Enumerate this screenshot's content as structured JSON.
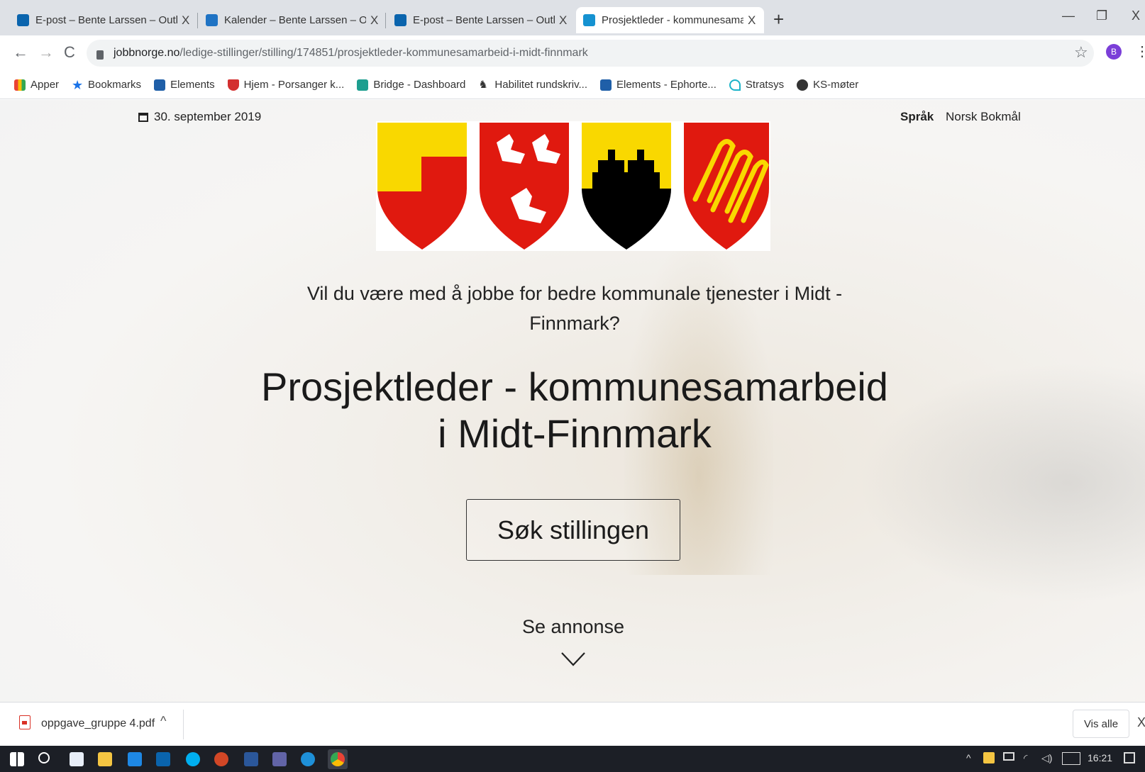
{
  "browser": {
    "tabs": [
      {
        "title": "E-post – Bente Larssen – Outlook",
        "active": false,
        "favicon_color": "#0a64ad"
      },
      {
        "title": "Kalender – Bente Larssen – Outlo",
        "active": false,
        "favicon_color": "#1f73c4"
      },
      {
        "title": "E-post – Bente Larssen – Outlook",
        "active": false,
        "favicon_color": "#0a64ad"
      },
      {
        "title": "Prosjektleder - kommunesamarb",
        "active": true,
        "favicon_color": "#1592d1"
      }
    ],
    "tab_close_glyph": "X",
    "new_tab_glyph": "+",
    "window_controls": {
      "minimize": "—",
      "restore": "❐",
      "close": "X"
    },
    "url_host": "jobbnorge.no",
    "url_path": "/ledige-stillinger/stilling/174851/prosjektleder-kommunesamarbeid-i-midt-finnmark",
    "profile_initial": "B",
    "bookmarks": [
      {
        "label": "Apper",
        "icon": "apps-grid-icon",
        "color": "#ea4335"
      },
      {
        "label": "Bookmarks",
        "icon": "star-icon",
        "color": "#1a73e8"
      },
      {
        "label": "Elements",
        "icon": "elements-icon",
        "color": "#1f5fa8"
      },
      {
        "label": "Hjem - Porsanger k...",
        "icon": "porsanger-crest-icon",
        "color": "#d32f2f"
      },
      {
        "label": "Bridge - Dashboard",
        "icon": "bridge-icon",
        "color": "#1d9e8f"
      },
      {
        "label": "Habilitet rundskriv...",
        "icon": "lion-icon",
        "color": "#333333"
      },
      {
        "label": "Elements - Ephorte...",
        "icon": "elements-icon",
        "color": "#1f5fa8"
      },
      {
        "label": "Stratsys",
        "icon": "stratsys-icon",
        "color": "#1bb3c8"
      },
      {
        "label": "KS-møter",
        "icon": "globe-icon",
        "color": "#333333"
      }
    ]
  },
  "page": {
    "date": "30. september 2019",
    "language_label": "Språk",
    "language_value": "Norsk Bokmål",
    "intro": "Vil du være med å jobbe for bedre kommunale tjenester i Midt - Finnmark?",
    "title_line1": "Prosjektleder - kommunesamarbeid",
    "title_line2": "i Midt-Finnmark",
    "apply_button": "Søk stillingen",
    "see_ad": "Se annonse"
  },
  "downloads": {
    "file_name": "oppgave_gruppe 4.pdf",
    "show_all": "Vis alle",
    "close_glyph": "X"
  },
  "taskbar": {
    "clock": "16:21",
    "tray_caret": "^"
  },
  "colors": {
    "crest_red": "#e0190f",
    "crest_yellow": "#f9d800",
    "crest_black": "#000000"
  }
}
